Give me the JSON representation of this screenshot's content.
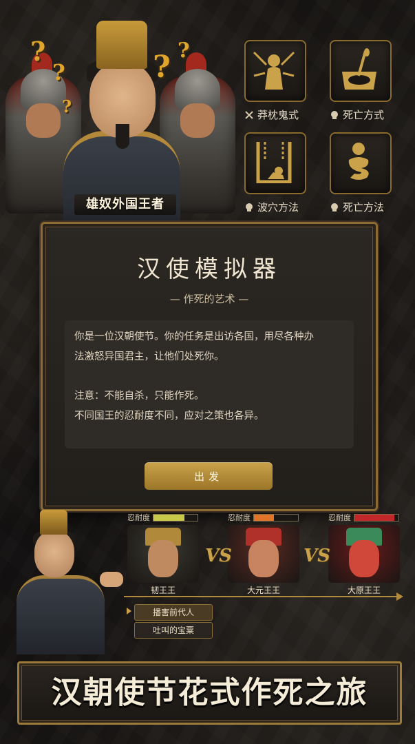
{
  "hero": {
    "caption": "雄奴外国王者",
    "question_mark": "?"
  },
  "icons": [
    {
      "label": "莽枕鬼式",
      "icon": "arrows-target-icon",
      "prefix_icon": "crossed-swords-icon"
    },
    {
      "label": "死亡方式",
      "icon": "pit-spear-icon",
      "prefix_icon": "skull-icon"
    },
    {
      "label": "波穴方法",
      "icon": "cage-icon",
      "prefix_icon": "skull-icon"
    },
    {
      "label": "死亡方法",
      "icon": "bound-figure-icon",
      "prefix_icon": "skull-icon"
    }
  ],
  "panel": {
    "title": "汉使模拟器",
    "subtitle": "— 作死的艺术 —",
    "lines": [
      "你是一位汉朝使节。你的任务是出访各国，用尽各种办",
      "法激怒异国君主，让他们处死你。",
      "注意：不能自杀，只能作死。",
      "不同国王的忍耐度不同，应对之策也各异。"
    ],
    "button": "出发"
  },
  "kings": [
    {
      "tolerance_label": "忍耐度",
      "tolerance": 0.7,
      "bar_color": "#c8c84a",
      "name": "韧王王",
      "theme": "#3a3a30"
    },
    {
      "tolerance_label": "忍耐度",
      "tolerance": 0.45,
      "bar_color": "#e0752a",
      "name": "大元王王",
      "theme": "#5a2a22"
    },
    {
      "tolerance_label": "忍耐度",
      "tolerance": 0.9,
      "bar_color": "#c2282a",
      "name": "大原王王",
      "theme": "#6a1a1a"
    }
  ],
  "vs": "VS",
  "options": [
    "播害前代人",
    "吐叫的宝粟"
  ],
  "banner": "汉朝使节花式作死之旅",
  "colors": {
    "gold": "#c9a24a",
    "border": "#8b6a33"
  }
}
